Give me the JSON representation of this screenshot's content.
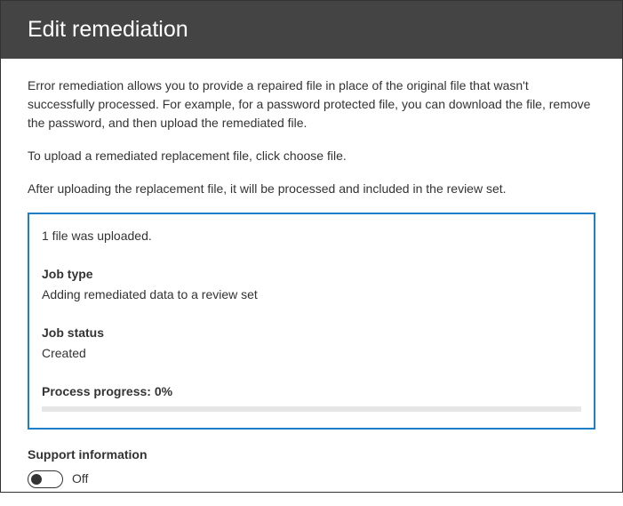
{
  "header": {
    "title": "Edit remediation"
  },
  "content": {
    "description": "Error remediation allows you to provide a repaired file in place of the original file that wasn't successfully processed. For example, for a password protected file, you can download the file, remove the password, and then upload the remediated file.",
    "instruction1": "To upload a remediated replacement file, click choose file.",
    "instruction2": "After uploading the replacement file, it will be processed and included in the review set."
  },
  "status": {
    "upload_message": "1 file was uploaded.",
    "job_type_label": "Job type",
    "job_type_value": "Adding remediated data to a review set",
    "job_status_label": "Job status",
    "job_status_value": "Created",
    "progress_label": "Process progress: 0%",
    "progress_percent": 0
  },
  "support": {
    "label": "Support information",
    "toggle_state": "Off"
  }
}
